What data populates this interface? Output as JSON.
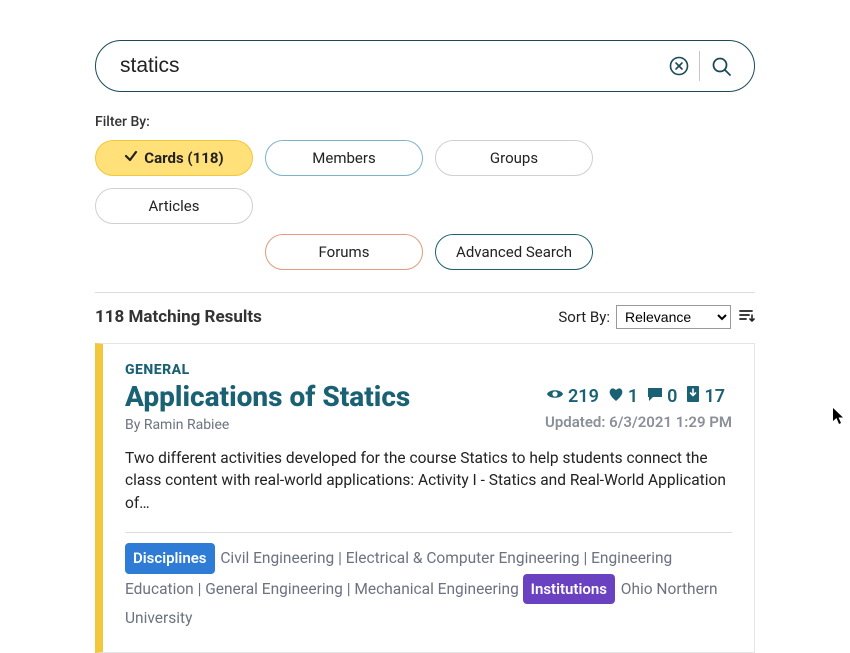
{
  "search": {
    "value": "statics"
  },
  "filter": {
    "label": "Filter By:",
    "active_label": "Cards (118)",
    "members": "Members",
    "groups": "Groups",
    "articles": "Articles",
    "forums": "Forums",
    "advanced": "Advanced Search"
  },
  "results": {
    "count_text": "118 Matching Results",
    "sort_label": "Sort By:",
    "sort_value": "Relevance"
  },
  "card": {
    "category": "GENERAL",
    "title": "Applications of Statics",
    "byline": "By Ramin Rabiee",
    "stats": {
      "views": "219",
      "likes": "1",
      "comments": "0",
      "downloads": "17"
    },
    "updated": "Updated: 6/3/2021 1:29 PM",
    "description": "Two different activities developed for the course Statics to help students connect the class content with real-world applications: Activity I - Statics and Real-World Application of…",
    "disciplines_label": "Disciplines",
    "disciplines_text": " Civil Engineering | Electrical & Computer Engineering | Engineering Education | General Engineering | Mechanical Engineering ",
    "institutions_label": "Institutions",
    "institutions_text": " Ohio Northern University"
  }
}
